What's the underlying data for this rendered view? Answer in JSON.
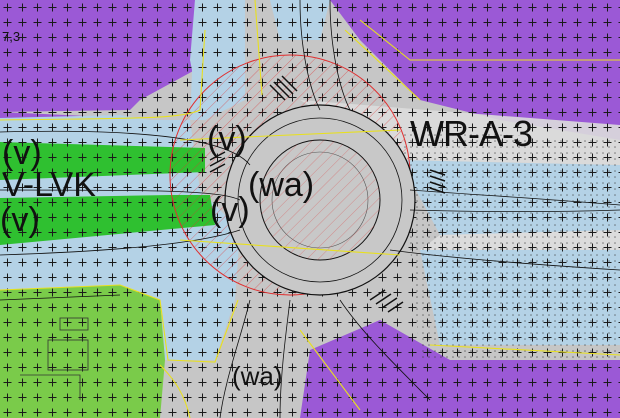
{
  "map": {
    "zone_labels": {
      "wr_a_3": "WR-A-3",
      "v_lvk": "V-LVK",
      "v_top_left": "(v)",
      "v_bottom_left": "(v)",
      "v_center_top": "(v)",
      "v_center": "(v)",
      "wa_center": "(wa)",
      "wa_bottom": "(wa)",
      "code_topleft": "7,3"
    },
    "colors": {
      "residential_purple": "#9b59d6",
      "road_grey": "#c6c6c6",
      "water_blue": "#b4d2e6",
      "green_zone": "#3fc23f",
      "green_light": "#7acb4a",
      "line_yellow": "#e8e020",
      "line_red": "#e03030"
    }
  }
}
